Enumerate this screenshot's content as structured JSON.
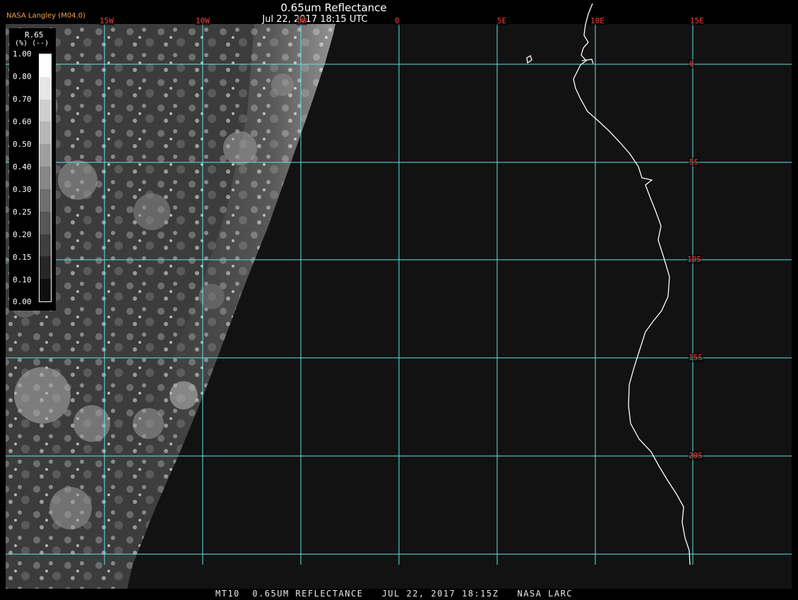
{
  "header": {
    "title": "0.65um Reflectance",
    "timestamp": "Jul 22, 2017 18:15 UTC",
    "credit": "NASA Langley (M04.0)"
  },
  "footer": {
    "caption": "MT10  0.65UM REFLECTANCE   JUL 22, 2017 18:15Z   NASA LARC"
  },
  "legend": {
    "name": "R.65",
    "unit": "(%) (--)",
    "ticks": [
      "1.00",
      "0.80",
      "0.70",
      "0.60",
      "0.50",
      "0.40",
      "0.30",
      "0.25",
      "0.20",
      "0.15",
      "0.10",
      "0.00"
    ]
  },
  "map": {
    "longitude_labels": [
      "15W",
      "10W",
      "5W",
      "0",
      "5E",
      "10E",
      "15E"
    ],
    "latitude_labels": [
      "0",
      "5S",
      "10S",
      "15S",
      "20S"
    ],
    "colors": {
      "grid": "#5ce6e6",
      "coastline": "#ffffff",
      "grid_label": "#ff3c3c",
      "background": "#121212"
    }
  }
}
